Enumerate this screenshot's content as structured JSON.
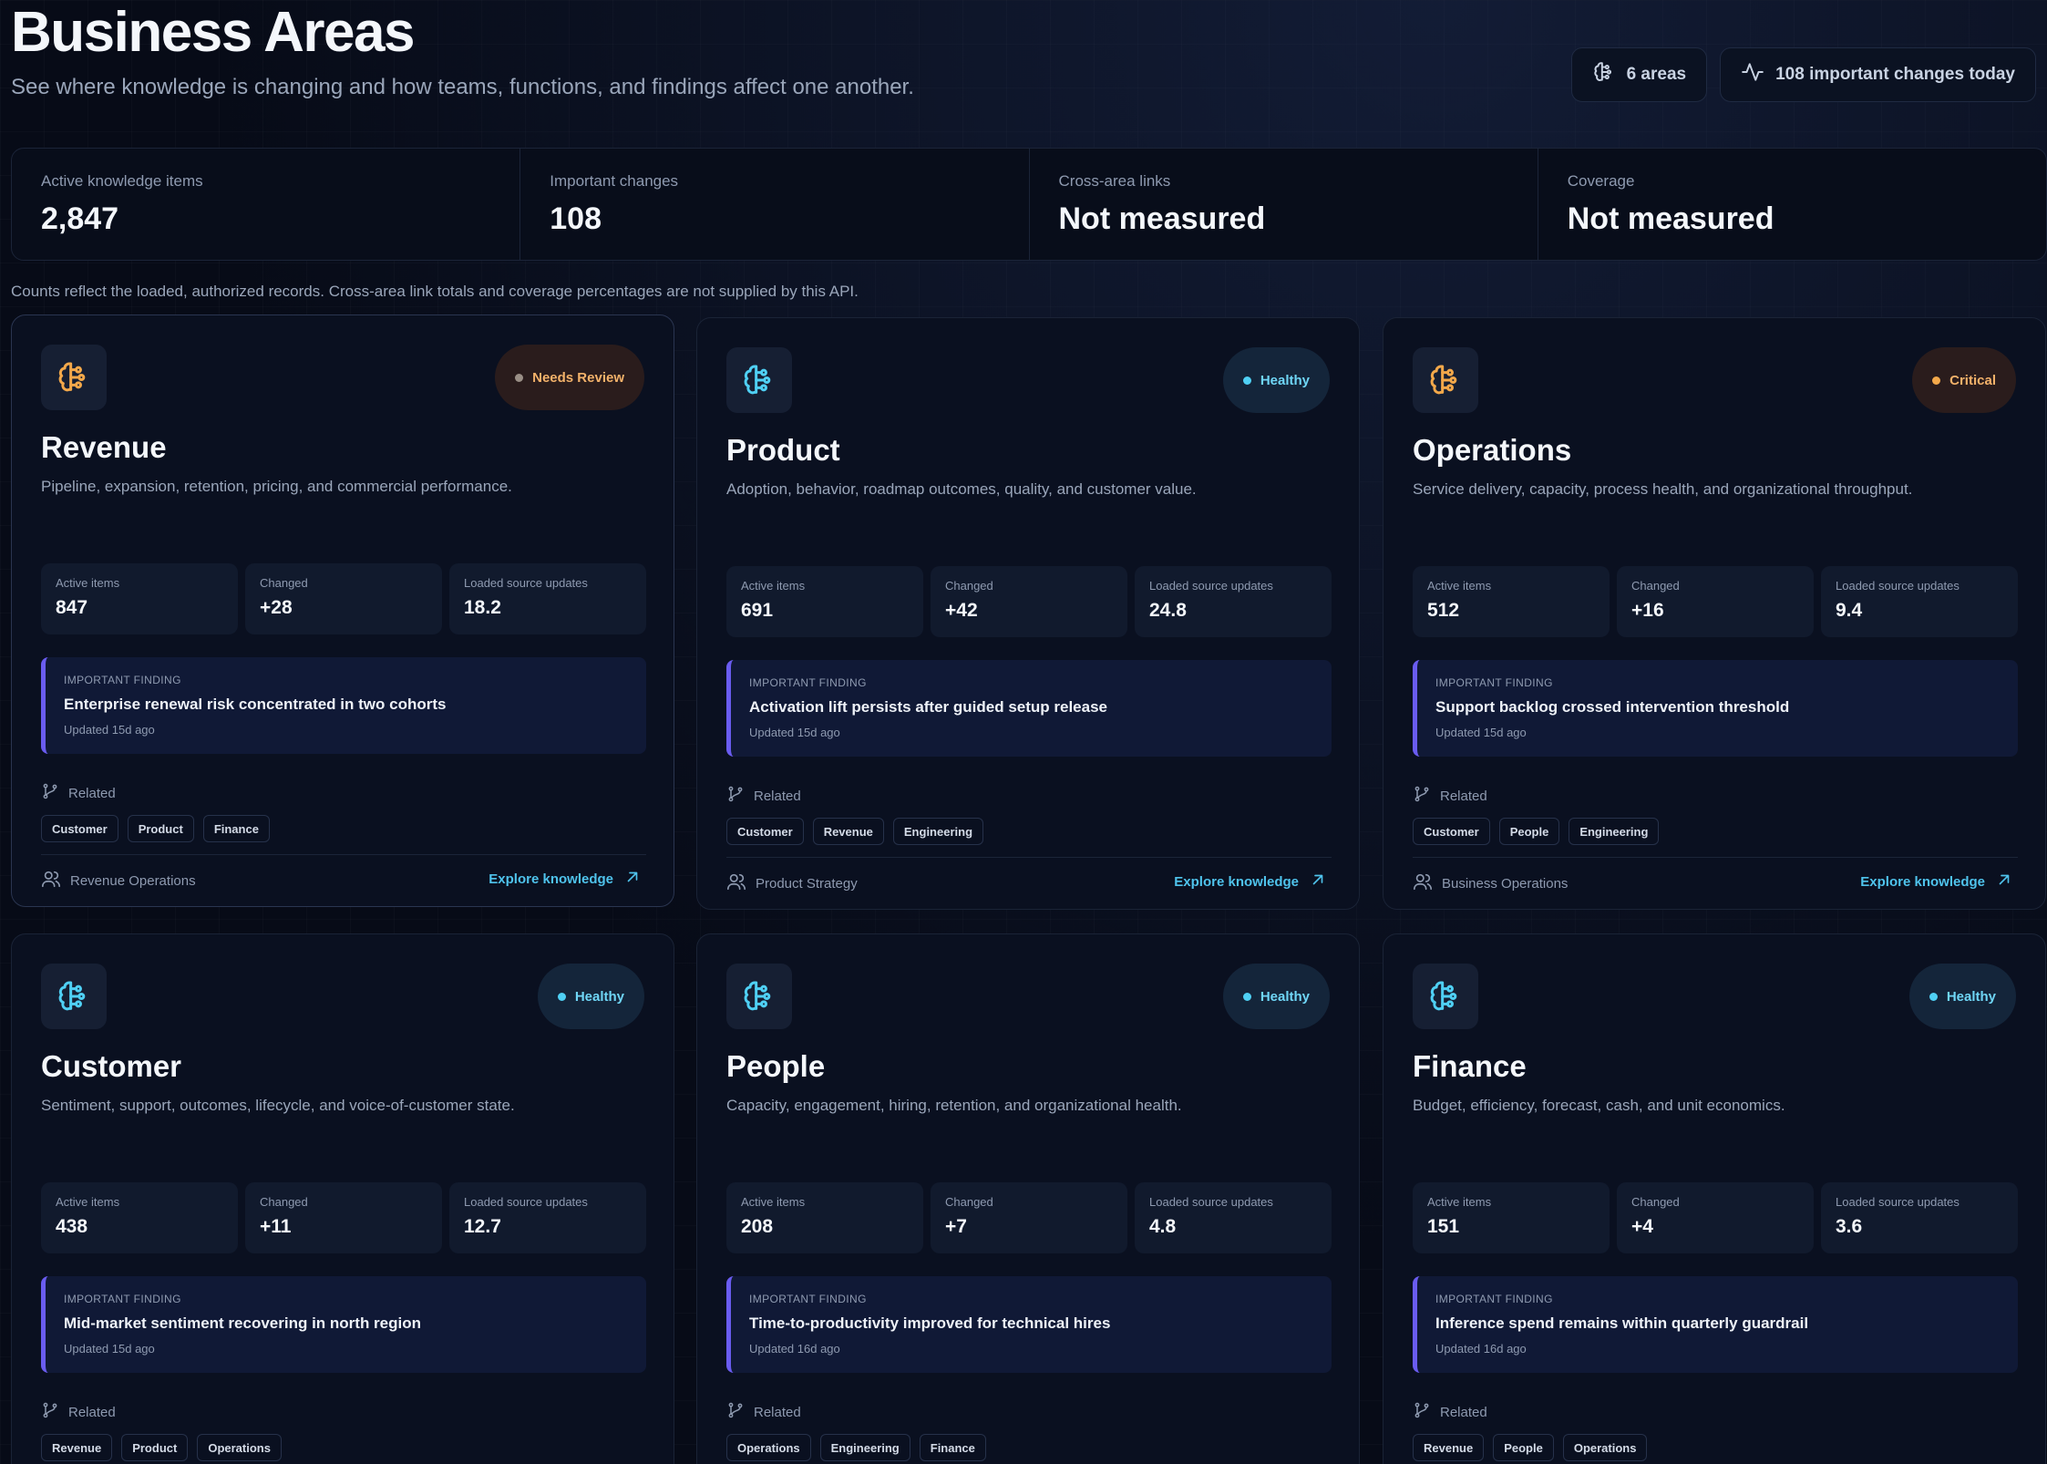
{
  "page": {
    "title": "Business Areas",
    "subtitle": "See where knowledge is changing and how teams, functions, and findings affect one another.",
    "areas_pill": "6 areas",
    "changes_pill": "108 important changes today"
  },
  "stats": [
    {
      "label": "Active knowledge items",
      "value": "2,847"
    },
    {
      "label": "Important changes",
      "value": "108"
    },
    {
      "label": "Cross-area links",
      "value": "Not measured"
    },
    {
      "label": "Coverage",
      "value": "Not measured"
    }
  ],
  "note": "Counts reflect the loaded, authorized records. Cross-area link totals and coverage percentages are not supplied by this API.",
  "labels": {
    "active_items": "Active items",
    "changed": "Changed",
    "loaded_updates": "Loaded source updates",
    "important_finding": "IMPORTANT FINDING",
    "related": "Related",
    "explore": "Explore knowledge"
  },
  "colors": {
    "accent": "#4fc3ec",
    "healthy": "#4fd0f4",
    "warning": "#f3a84a",
    "finding_border": "#6a5cf0",
    "background": "#070b17"
  },
  "cards": [
    {
      "name": "Revenue",
      "status": "Needs Review",
      "status_kind": "review",
      "icon_color": "orange",
      "description": "Pipeline, expansion, retention, pricing, and commercial performance.",
      "active_items": "847",
      "changed": "+28",
      "loaded_updates": "18.2",
      "finding_title": "Enterprise renewal risk concentrated in two cohorts",
      "finding_updated": "Updated 15d ago",
      "related": [
        "Customer",
        "Product",
        "Finance"
      ],
      "owner": "Revenue Operations",
      "footer": true
    },
    {
      "name": "Product",
      "status": "Healthy",
      "status_kind": "healthy",
      "icon_color": "cyan",
      "description": "Adoption, behavior, roadmap outcomes, quality, and customer value.",
      "active_items": "691",
      "changed": "+42",
      "loaded_updates": "24.8",
      "finding_title": "Activation lift persists after guided setup release",
      "finding_updated": "Updated 15d ago",
      "related": [
        "Customer",
        "Revenue",
        "Engineering"
      ],
      "owner": "Product Strategy",
      "footer": true
    },
    {
      "name": "Operations",
      "status": "Critical",
      "status_kind": "critical",
      "icon_color": "orange",
      "description": "Service delivery, capacity, process health, and organizational throughput.",
      "active_items": "512",
      "changed": "+16",
      "loaded_updates": "9.4",
      "finding_title": "Support backlog crossed intervention threshold",
      "finding_updated": "Updated 15d ago",
      "related": [
        "Customer",
        "People",
        "Engineering"
      ],
      "owner": "Business Operations",
      "footer": true
    },
    {
      "name": "Customer",
      "status": "Healthy",
      "status_kind": "healthy",
      "icon_color": "cyan",
      "description": "Sentiment, support, outcomes, lifecycle, and voice-of-customer state.",
      "active_items": "438",
      "changed": "+11",
      "loaded_updates": "12.7",
      "finding_title": "Mid-market sentiment recovering in north region",
      "finding_updated": "Updated 15d ago",
      "related": [
        "Revenue",
        "Product",
        "Operations"
      ],
      "owner": "",
      "footer": false
    },
    {
      "name": "People",
      "status": "Healthy",
      "status_kind": "healthy",
      "icon_color": "cyan",
      "description": "Capacity, engagement, hiring, retention, and organizational health.",
      "active_items": "208",
      "changed": "+7",
      "loaded_updates": "4.8",
      "finding_title": "Time-to-productivity improved for technical hires",
      "finding_updated": "Updated 16d ago",
      "related": [
        "Operations",
        "Engineering",
        "Finance"
      ],
      "owner": "",
      "footer": false
    },
    {
      "name": "Finance",
      "status": "Healthy",
      "status_kind": "healthy",
      "icon_color": "cyan",
      "description": "Budget, efficiency, forecast, cash, and unit economics.",
      "active_items": "151",
      "changed": "+4",
      "loaded_updates": "3.6",
      "finding_title": "Inference spend remains within quarterly guardrail",
      "finding_updated": "Updated 16d ago",
      "related": [
        "Revenue",
        "People",
        "Operations"
      ],
      "owner": "",
      "footer": false
    }
  ]
}
